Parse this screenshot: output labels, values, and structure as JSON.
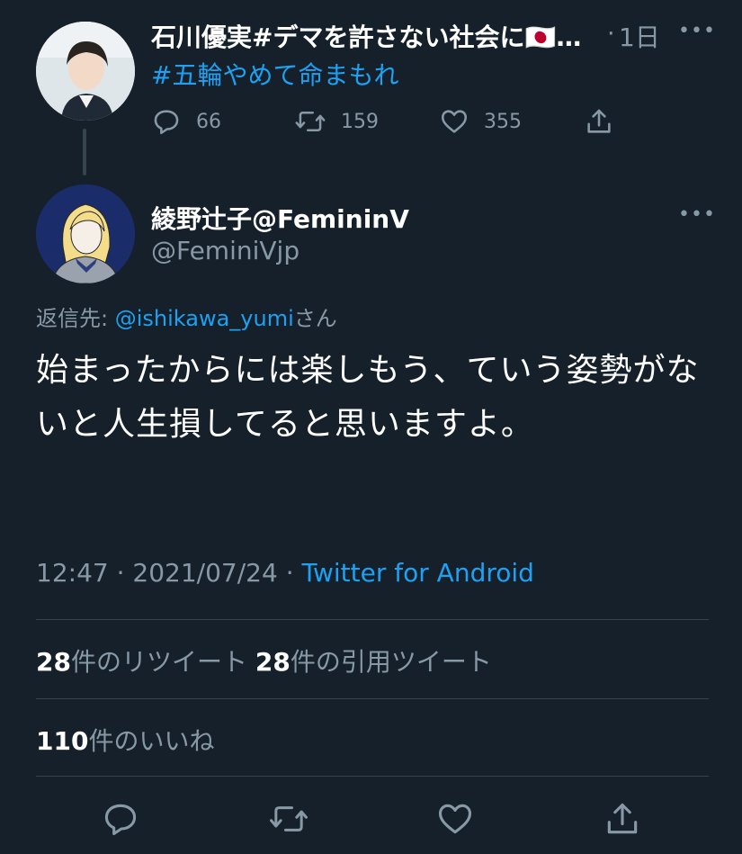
{
  "parent_tweet": {
    "author_name": "石川優実#デマを許さない社会に🇯🇵…",
    "separator": "·",
    "time_ago": "1日",
    "hashtag": "#五輪やめて命まもれ",
    "stats": {
      "replies": "66",
      "retweets": "159",
      "likes": "355"
    },
    "more_label": "•••"
  },
  "main_tweet": {
    "author_name": "綾野辻子@FemininV",
    "handle": "@FeminiVjp",
    "more_label": "•••",
    "reply_prefix": "返信先: ",
    "reply_mention": "@ishikawa_yumi",
    "reply_suffix": "さん",
    "text": "始まったからには楽しもう、ていう姿勢がないと人生損してると思いますよ。",
    "time": "12:47",
    "date": "2021/07/24",
    "meta_sep": "·",
    "client": "Twitter for Android",
    "retweet_count": "28",
    "retweet_label": "件のリツイート",
    "quote_count": "28",
    "quote_label": "件の引用ツイート",
    "like_count": "110",
    "like_label": "件のいいね"
  },
  "colors": {
    "background": "#15202b",
    "text_primary": "#ffffff",
    "text_secondary": "#8899a6",
    "accent": "#1da1f2",
    "divider": "#38444d"
  },
  "icons": [
    "reply-icon",
    "retweet-icon",
    "like-icon",
    "share-icon",
    "more-icon"
  ]
}
